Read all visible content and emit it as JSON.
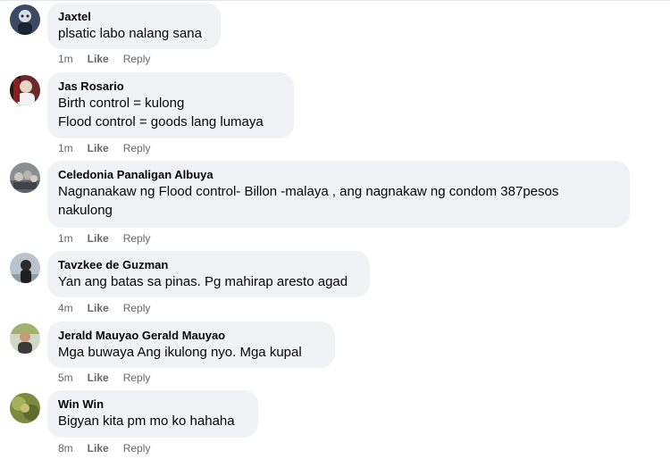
{
  "comments": [
    {
      "author": "Jaxtel",
      "lines": [
        "plsatic labo nalang sana"
      ],
      "time": "1m",
      "like": "Like",
      "reply": "Reply"
    },
    {
      "author": "Jas Rosario",
      "lines": [
        "Birth control = kulong",
        "Flood control = goods lang lumaya"
      ],
      "time": "1m",
      "like": "Like",
      "reply": "Reply"
    },
    {
      "author": "Celedonia Panaligan Albuya",
      "lines": [
        "Nagnanakaw ng Flood control- Billon -malaya , ang nagnakaw ng condom 387pesos",
        "nakulong"
      ],
      "time": "1m",
      "like": "Like",
      "reply": "Reply"
    },
    {
      "author": "Tavzkee de Guzman",
      "lines": [
        "Yan ang batas sa pinas. Pg mahirap aresto agad"
      ],
      "time": "4m",
      "like": "Like",
      "reply": "Reply"
    },
    {
      "author": "Jerald Mauyao Gerald Mauyao",
      "lines": [
        "Mga buwaya Ang ikulong nyo. Mga kupal"
      ],
      "time": "5m",
      "like": "Like",
      "reply": "Reply"
    },
    {
      "author": "Win Win",
      "lines": [
        "Bigyan kita pm mo ko hahaha"
      ],
      "time": "8m",
      "like": "Like",
      "reply": "Reply"
    }
  ],
  "colors": {
    "bubble": "#f0f2f5",
    "meta_text": "#65676b",
    "body_text": "#050505"
  }
}
